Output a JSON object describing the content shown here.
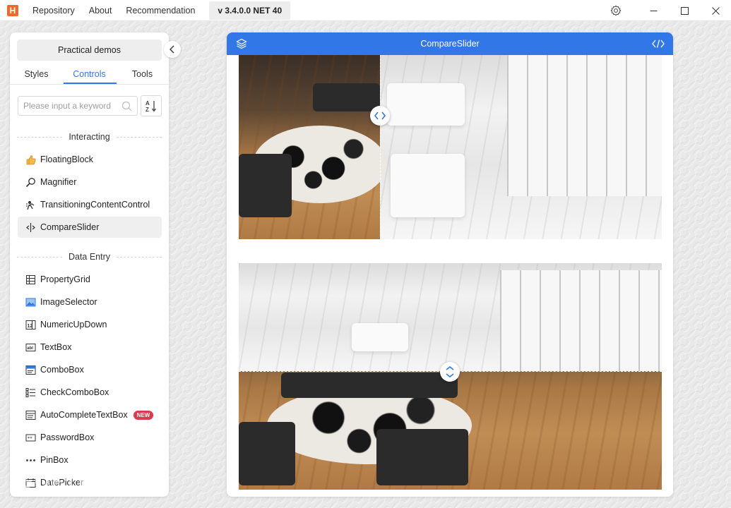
{
  "titlebar": {
    "logo_letter": "H",
    "menu": [
      "Repository",
      "About",
      "Recommendation"
    ],
    "version": "v 3.4.0.0 NET 40"
  },
  "sidebar": {
    "demos_button": "Practical demos",
    "tabs": [
      {
        "label": "Styles",
        "active": false
      },
      {
        "label": "Controls",
        "active": true
      },
      {
        "label": "Tools",
        "active": false
      }
    ],
    "search_placeholder": "Please input a keyword",
    "groups": [
      {
        "title": "Interacting",
        "items": [
          {
            "label": "FloatingBlock",
            "icon": "thumbs-up-icon"
          },
          {
            "label": "Magnifier",
            "icon": "magnifier-icon"
          },
          {
            "label": "TransitioningContentControl",
            "icon": "transition-icon"
          },
          {
            "label": "CompareSlider",
            "icon": "compare-slider-icon",
            "selected": true
          }
        ]
      },
      {
        "title": "Data Entry",
        "items": [
          {
            "label": "PropertyGrid",
            "icon": "property-grid-icon"
          },
          {
            "label": "ImageSelector",
            "icon": "image-icon"
          },
          {
            "label": "NumericUpDown",
            "icon": "numeric-icon"
          },
          {
            "label": "TextBox",
            "icon": "textbox-icon"
          },
          {
            "label": "ComboBox",
            "icon": "combobox-icon"
          },
          {
            "label": "CheckComboBox",
            "icon": "check-list-icon"
          },
          {
            "label": "AutoCompleteTextBox",
            "icon": "autocomplete-icon",
            "badge": "NEW"
          },
          {
            "label": "PasswordBox",
            "icon": "password-icon"
          },
          {
            "label": "PinBox",
            "icon": "dots-icon"
          },
          {
            "label": "DatePicker",
            "icon": "calendar-icon"
          }
        ]
      }
    ]
  },
  "main": {
    "title": "CompareSlider",
    "accent_color": "#3277e8"
  },
  "watermark": "SOFTPEDIA"
}
